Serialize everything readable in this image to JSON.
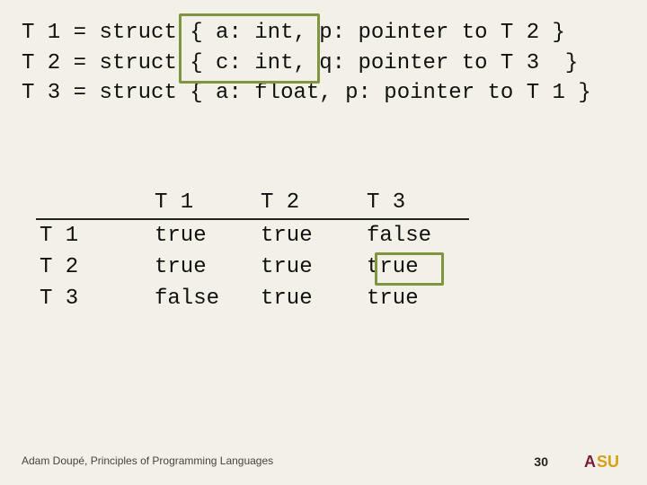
{
  "defs": [
    {
      "name": "T 1",
      "body": "struct { a: int, p: pointer to T 2 }"
    },
    {
      "name": "T 2",
      "body": "struct { c: int, q: pointer to T 3  }"
    },
    {
      "name": "T 3",
      "body": "struct { a: float, p: pointer to T 1 }"
    }
  ],
  "table": {
    "cols": [
      "T 1",
      "T 2",
      "T 3"
    ],
    "rows": [
      "T 1",
      "T 2",
      "T 3"
    ],
    "cells": [
      [
        "true",
        "true",
        "false"
      ],
      [
        "true",
        "true",
        "true"
      ],
      [
        "false",
        "true",
        "true"
      ]
    ]
  },
  "footer": "Adam Doupé, Principles of Programming Languages",
  "pagenum": "30",
  "logo": {
    "a": "A",
    "su": "SU"
  }
}
